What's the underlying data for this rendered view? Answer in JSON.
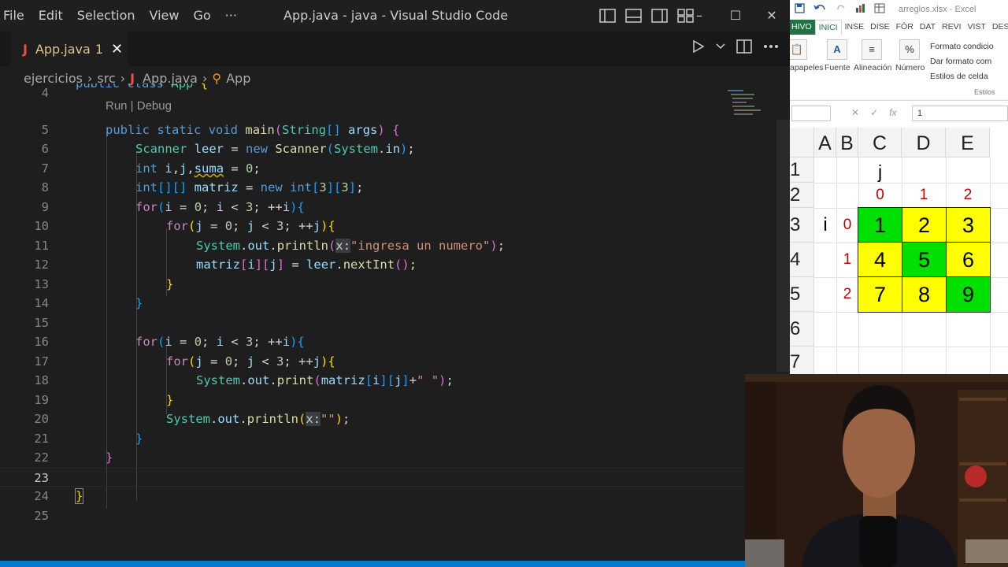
{
  "vscode": {
    "menu": [
      "File",
      "Edit",
      "Selection",
      "View",
      "Go",
      "···"
    ],
    "window_title": "App.java - java - Visual Studio Code",
    "window_controls": [
      "–",
      "☐",
      "✕"
    ],
    "tab": {
      "icon": "J",
      "label": "App.java",
      "problems": "1",
      "close": "✕"
    },
    "breadcrumbs": [
      "ejercicios",
      "src",
      "App.java",
      "App"
    ],
    "codelens": "Run | Debug",
    "line_numbers": [
      "4",
      "5",
      "6",
      "7",
      "8",
      "9",
      "10",
      "11",
      "12",
      "13",
      "14",
      "15",
      "16",
      "17",
      "18",
      "19",
      "20",
      "21",
      "22",
      "23",
      "24",
      "25"
    ]
  },
  "excel": {
    "filename": "arreglos.xlsx - Excel",
    "ribbon_tabs": [
      "HIVO",
      "INICI",
      "INSE",
      "DISE",
      "FÓR",
      "DAT",
      "REVI",
      "VIST",
      "DES"
    ],
    "groups": [
      "apapeles",
      "Fuente",
      "Alineación",
      "Número"
    ],
    "styles": [
      "Formato condicio",
      "Dar formato com",
      "Estilos de celda"
    ],
    "styles_group": "Estilos",
    "formula_value": "1",
    "columns": [
      "A",
      "B",
      "C",
      "D",
      "E"
    ],
    "rows": [
      "1",
      "2",
      "3",
      "4",
      "5",
      "6",
      "7"
    ],
    "j_label": "j",
    "i_label": "i",
    "col_indices": [
      "0",
      "1",
      "2"
    ],
    "row_indices": [
      "0",
      "1",
      "2"
    ],
    "matrix": [
      [
        "1",
        "2",
        "3"
      ],
      [
        "4",
        "5",
        "6"
      ],
      [
        "7",
        "8",
        "9"
      ]
    ],
    "colors": {
      "diagonal": "#00e000",
      "other": "#ffff00",
      "index": "#c00000"
    }
  }
}
